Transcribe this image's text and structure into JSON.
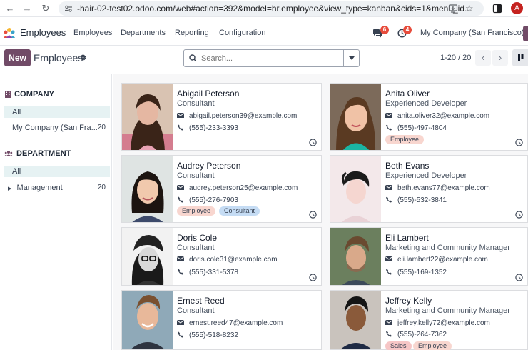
{
  "browser": {
    "url": "-hair-02-test02.odoo.com/web#action=392&model=hr.employee&view_type=kanban&cids=1&menu_id...",
    "avatar": "A"
  },
  "navbar": {
    "app_name": "Employees",
    "menu": [
      "Employees",
      "Departments",
      "Reporting",
      "Configuration"
    ],
    "messages_count": "6",
    "activities_count": "4",
    "company": "My Company (San Francisco)"
  },
  "control": {
    "new_label": "New",
    "title": "Employees",
    "search_placeholder": "Search...",
    "pager": "1-20 / 20"
  },
  "sidebar": {
    "company_heading": "COMPANY",
    "company_items": [
      {
        "label": "All",
        "count": ""
      },
      {
        "label": "My Company (San Fra...",
        "count": "20"
      }
    ],
    "department_heading": "DEPARTMENT",
    "department_items": [
      {
        "label": "All",
        "count": ""
      },
      {
        "label": "Management",
        "count": "20"
      }
    ]
  },
  "employees": [
    {
      "name": "Abigail Peterson",
      "job": "Consultant",
      "email": "abigail.peterson39@example.com",
      "phone": "(555)-233-3393",
      "tags": []
    },
    {
      "name": "Anita Oliver",
      "job": "Experienced Developer",
      "email": "anita.oliver32@example.com",
      "phone": "(555)-497-4804",
      "tags": [
        "Employee"
      ]
    },
    {
      "name": "Audrey Peterson",
      "job": "Consultant",
      "email": "audrey.peterson25@example.com",
      "phone": "(555)-276-7903",
      "tags": [
        "Employee",
        "Consultant"
      ]
    },
    {
      "name": "Beth Evans",
      "job": "Experienced Developer",
      "email": "beth.evans77@example.com",
      "phone": "(555)-532-3841",
      "tags": []
    },
    {
      "name": "Doris Cole",
      "job": "Consultant",
      "email": "doris.cole31@example.com",
      "phone": "(555)-331-5378",
      "tags": []
    },
    {
      "name": "Eli Lambert",
      "job": "Marketing and Community Manager",
      "email": "eli.lambert22@example.com",
      "phone": "(555)-169-1352",
      "tags": []
    },
    {
      "name": "Ernest Reed",
      "job": "Consultant",
      "email": "ernest.reed47@example.com",
      "phone": "(555)-518-8232",
      "tags": []
    },
    {
      "name": "Jeffrey Kelly",
      "job": "Marketing and Community Manager",
      "email": "jeffrey.kelly72@example.com",
      "phone": "(555)-264-7362",
      "tags": [
        "Sales",
        "Employee"
      ]
    }
  ],
  "colors": {
    "brand": "#714b67",
    "badge": "#e74c3c",
    "active_filter": "#e6f2f3"
  }
}
